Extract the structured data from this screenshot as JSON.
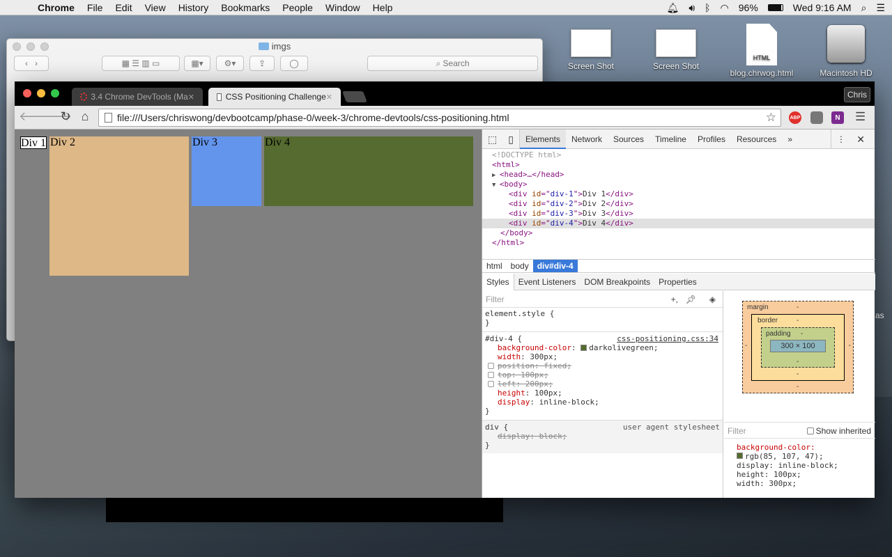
{
  "menubar": {
    "app": "Chrome",
    "items": [
      "File",
      "Edit",
      "View",
      "History",
      "Bookmarks",
      "People",
      "Window",
      "Help"
    ],
    "battery": "96%",
    "clock": "Wed 9:16 AM"
  },
  "desktop": {
    "icons": [
      "Screen Shot",
      "Screen Shot",
      "blog.chrwog.html",
      "Macintosh HD"
    ],
    "html_badge": "HTML",
    "stray_text": "as"
  },
  "finder": {
    "title": "imgs",
    "search_placeholder": "Search"
  },
  "chrome": {
    "tabs": [
      {
        "label": "3.4 Chrome DevTools (Ma",
        "active": false
      },
      {
        "label": "CSS Positioning Challenge",
        "active": true
      }
    ],
    "url": "file:///Users/chriswong/devbootcamp/phase-0/week-3/chrome-devtools/css-positioning.html",
    "profile": "Chris",
    "extensions": [
      "ABP",
      "N"
    ]
  },
  "page": {
    "divs": [
      {
        "label": "Div 1",
        "color": "#ffffff"
      },
      {
        "label": "Div 2",
        "color": "#deb887"
      },
      {
        "label": "Div 3",
        "color": "#6495ed"
      },
      {
        "label": "Div 4",
        "color": "#556b2f"
      }
    ],
    "background": "#808080"
  },
  "devtools": {
    "tabs": [
      "Elements",
      "Network",
      "Sources",
      "Timeline",
      "Profiles",
      "Resources"
    ],
    "more": "»",
    "dom": [
      "<!DOCTYPE html>",
      "<html>",
      "<head>…</head>",
      "<body>",
      "<div id=\"div-1\">Div 1</div>",
      "<div id=\"div-2\">Div 2</div>",
      "<div id=\"div-3\">Div 3</div>",
      "<div id=\"div-4\">Div 4</div>",
      "</body>",
      "</html>"
    ],
    "breadcrumbs": [
      "html",
      "body",
      "div#div-4"
    ],
    "subtabs": [
      "Styles",
      "Event Listeners",
      "DOM Breakpoints",
      "Properties"
    ],
    "filter_placeholder": "Filter",
    "styles": {
      "element_style": "element.style {",
      "close": "}",
      "rule_selector": "#div-4 {",
      "rule_source": "css-positioning.css:34",
      "props": [
        {
          "name": "background-color",
          "value": "darkolivegreen;",
          "struck": false,
          "checkbox": false,
          "swatch": "#556b2f"
        },
        {
          "name": "width",
          "value": "300px;",
          "struck": false,
          "checkbox": false
        },
        {
          "name": "position",
          "value": "fixed;",
          "struck": true,
          "checkbox": true
        },
        {
          "name": "top",
          "value": "100px;",
          "struck": true,
          "checkbox": true
        },
        {
          "name": "left",
          "value": "200px;",
          "struck": true,
          "checkbox": true
        },
        {
          "name": "height",
          "value": "100px;",
          "struck": false,
          "checkbox": false
        },
        {
          "name": "display",
          "value": "inline-block;",
          "struck": false,
          "checkbox": false
        }
      ],
      "ua_selector": "div {",
      "ua_source": "user agent stylesheet",
      "ua_prop": "display: block;"
    },
    "metrics": {
      "margin": "margin",
      "border": "border",
      "padding": "padding",
      "dash": "-",
      "content": "300 × 100"
    },
    "computed": {
      "filter": "Filter",
      "show_inherited": "Show inherited",
      "lines": [
        "background-color:",
        "rgb(85, 107, 47);",
        "display: inline-block;",
        "height: 100px;",
        "width: 300px;"
      ]
    }
  }
}
